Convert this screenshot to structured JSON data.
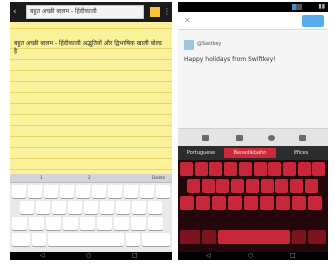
{
  "left_phone": {
    "title_field": "बहुत अच्छी बालम - हिंदीकाजी",
    "note_text": "बहुत अच्छी बालम - हिंदीकाजी अद्भुतियों और द्विभाषिक खाली बोल्ड है",
    "suggestions": [
      "1",
      "2",
      "Delete"
    ],
    "colors": {
      "note": "#fbf19a",
      "sticky": "#f6c534"
    }
  },
  "right_phone": {
    "handle": "@Switkey",
    "tweet_text": "Happy holidays from Swiftkey!",
    "suggestions": [
      "Portuguese",
      "Benedikbahn",
      "Iffices"
    ],
    "colors": {
      "keyboard_key": "#c8273a",
      "send_button": "#55acee"
    }
  }
}
